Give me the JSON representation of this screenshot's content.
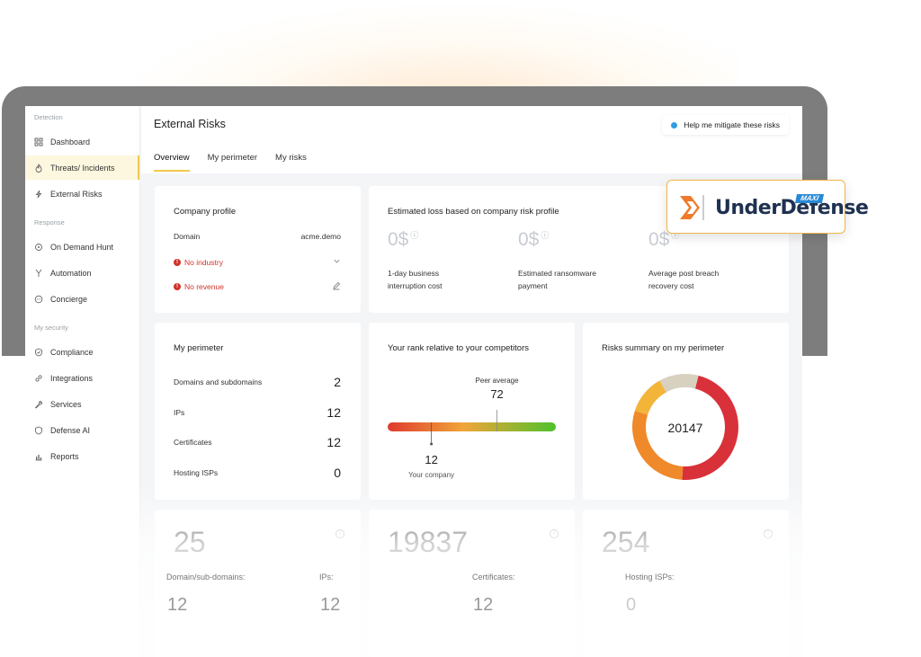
{
  "sidebar": {
    "sections": [
      {
        "label": "Detection",
        "items": [
          {
            "label": "Dashboard",
            "icon": "grid-icon"
          },
          {
            "label": "Threats/ Incidents",
            "icon": "flame-icon",
            "active": true
          },
          {
            "label": "External Risks",
            "icon": "bolt-icon"
          }
        ]
      },
      {
        "label": "Response",
        "items": [
          {
            "label": "On Demand Hunt",
            "icon": "crosshair-icon"
          },
          {
            "label": "Automation",
            "icon": "branch-icon"
          },
          {
            "label": "Concierge",
            "icon": "chat-icon"
          }
        ]
      },
      {
        "label": "My security",
        "items": [
          {
            "label": "Compliance",
            "icon": "shield-check-icon"
          },
          {
            "label": "Integrations",
            "icon": "link-icon"
          },
          {
            "label": "Services",
            "icon": "wrench-icon"
          },
          {
            "label": "Defense AI",
            "icon": "shield-icon"
          },
          {
            "label": "Reports",
            "icon": "bar-chart-icon"
          }
        ]
      }
    ]
  },
  "header": {
    "title": "External Risks",
    "help_label": "Help me mitigate these risks",
    "tabs": [
      "Overview",
      "My perimeter",
      "My risks"
    ]
  },
  "company_profile": {
    "title": "Company profile",
    "domain_label": "Domain",
    "domain_value": "acme.demo",
    "industry_warning": "No industry",
    "revenue_warning": "No revenue"
  },
  "estimated_loss": {
    "title": "Estimated loss based on company risk profile",
    "items": [
      {
        "value": "0$",
        "label_line1": "1-day business",
        "label_line2": "interruption cost"
      },
      {
        "value": "0$",
        "label_line1": "Estimated ransomware",
        "label_line2": "payment"
      },
      {
        "value": "0$",
        "label_line1": "Average post breach",
        "label_line2": "recovery cost"
      }
    ]
  },
  "my_perimeter": {
    "title": "My perimeter",
    "rows": [
      {
        "label": "Domains and subdomains",
        "value": "2"
      },
      {
        "label": "IPs",
        "value": "12"
      },
      {
        "label": "Certificates",
        "value": "12"
      },
      {
        "label": "Hosting ISPs",
        "value": "0"
      }
    ]
  },
  "rank": {
    "title": "Your rank relative to your competitors",
    "peer_label": "Peer average",
    "peer_value": "72",
    "company_value": "12",
    "company_label": "Your company",
    "peer_fraction": 0.65,
    "company_fraction": 0.26
  },
  "risks_summary": {
    "title": "Risks summary on my perimeter",
    "total": "20147",
    "segments": [
      {
        "fraction": 0.47,
        "color": "#d9313a"
      },
      {
        "fraction": 0.29,
        "color": "#f0892a"
      },
      {
        "fraction": 0.12,
        "color": "#f3b43a"
      },
      {
        "fraction": 0.12,
        "color": "#d8d1c0"
      }
    ]
  },
  "stats": [
    {
      "value": "25"
    },
    {
      "value": "19837"
    },
    {
      "value": "254"
    }
  ],
  "sub_stats": [
    {
      "label": "Domain/sub-domains:",
      "value": "12"
    },
    {
      "label": "IPs:",
      "value": "12"
    },
    {
      "label": "Certificates:",
      "value": "12"
    },
    {
      "label": "Hosting ISPs:",
      "value": "0"
    }
  ],
  "logo": {
    "name": "UnderDefense",
    "tag": "MAXI",
    "colors": {
      "primary": "#1f3150",
      "accent": "#f07a2b",
      "tag": "#2a89d4"
    }
  }
}
